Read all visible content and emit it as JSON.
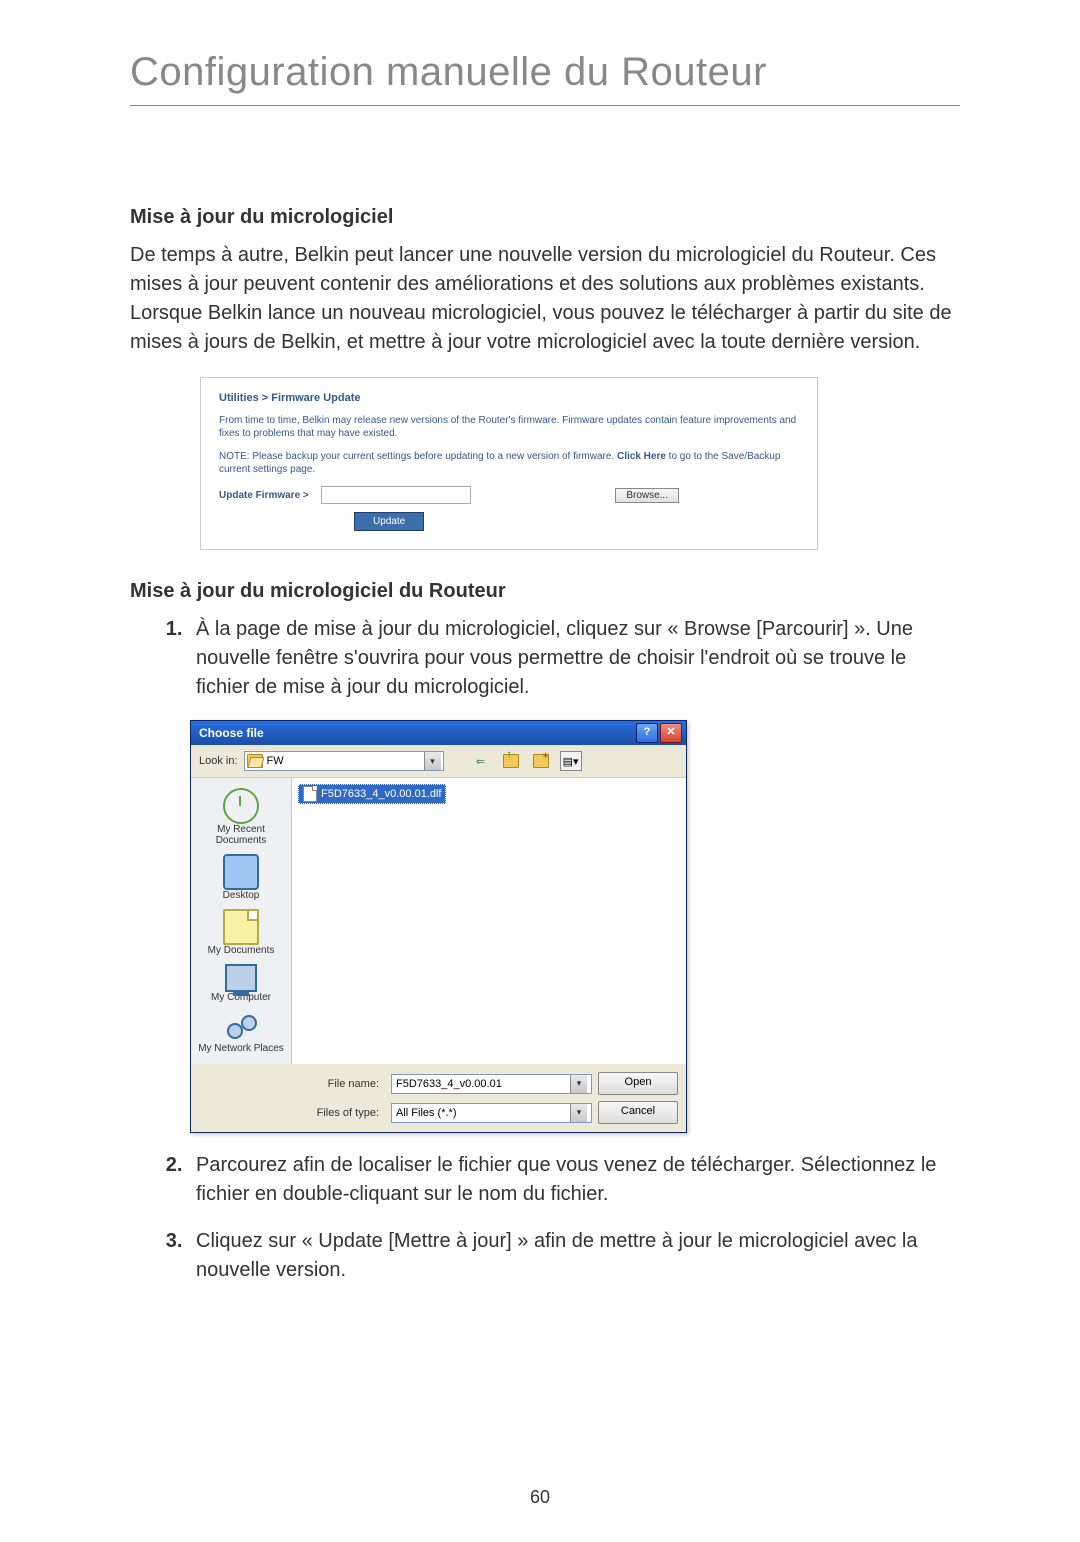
{
  "page": {
    "title": "Configuration manuelle du Routeur",
    "number": "60"
  },
  "section1": {
    "heading": "Mise à jour du micrologiciel",
    "para": "De temps à autre, Belkin peut lancer une nouvelle version du micrologiciel du Routeur. Ces mises à jour peuvent contenir des améliorations et des solutions aux problèmes existants. Lorsque Belkin lance un nouveau micrologiciel, vous pouvez le télécharger à partir du site de mises à jours de Belkin, et mettre à jour votre micrologiciel avec la toute dernière version."
  },
  "fw_panel": {
    "breadcrumb": "Utilities > Firmware Update",
    "text1": "From time to time, Belkin may release new versions of the Router's firmware. Firmware updates contain feature improvements and fixes to problems that may have existed.",
    "text2_pre": "NOTE: Please backup your current settings before updating to a new version of firmware. ",
    "text2_link": "Click Here",
    "text2_post": " to go to the Save/Backup current settings page.",
    "update_label": "Update Firmware >",
    "browse_btn": "Browse...",
    "update_btn": "Update"
  },
  "section2": {
    "heading": "Mise à jour du micrologiciel du Routeur",
    "step1": "À la page de mise à jour du micrologiciel, cliquez sur « Browse [Parcourir] ». Une nouvelle fenêtre s'ouvrira pour vous permettre de choisir l'endroit où se trouve le fichier de mise à jour du micrologiciel.",
    "step2": "Parcourez afin de localiser le fichier que vous venez de télécharger. Sélectionnez le fichier en double-cliquant sur le nom du fichier.",
    "step3": "Cliquez sur « Update [Mettre à jour] » afin de mettre à jour le micrologiciel avec la nouvelle version."
  },
  "dialog": {
    "title": "Choose file",
    "help_btn": "?",
    "close_btn": "✕",
    "lookin_label": "Look in:",
    "lookin_value": "FW",
    "toolbar_icons": [
      "back-icon",
      "up-icon",
      "new-folder-icon",
      "views-icon"
    ],
    "places": [
      {
        "label": "My Recent Documents"
      },
      {
        "label": "Desktop"
      },
      {
        "label": "My Documents"
      },
      {
        "label": "My Computer"
      },
      {
        "label": "My Network Places"
      }
    ],
    "file_selected": "F5D7633_4_v0.00.01.dlf",
    "filename_label": "File name:",
    "filename_value": "F5D7633_4_v0.00.01",
    "filetype_label": "Files of type:",
    "filetype_value": "All Files (*.*)",
    "open_btn": "Open",
    "cancel_btn": "Cancel"
  }
}
